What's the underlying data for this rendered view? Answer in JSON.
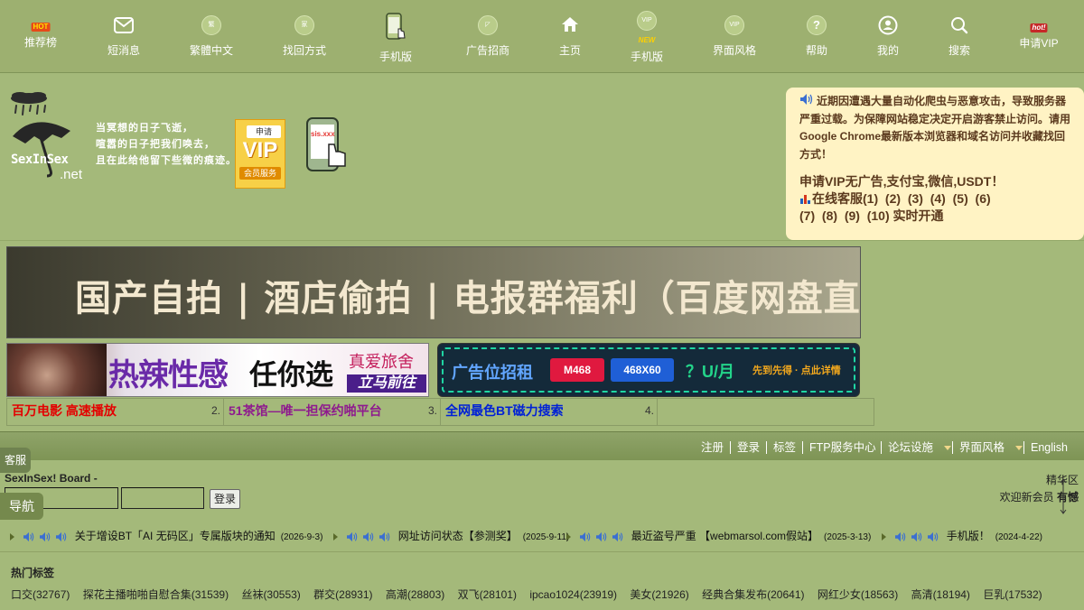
{
  "topnav": {
    "items": [
      {
        "label": "推荐榜",
        "badge": "HOT",
        "icon": "hot-icon"
      },
      {
        "label": "短消息",
        "icon": "mail-icon"
      },
      {
        "label": "繁體中文",
        "icon": "traditional-chinese-icon",
        "icon_text": "繁"
      },
      {
        "label": "找回方式",
        "icon": "retrieve-icon",
        "icon_text": "家"
      },
      {
        "label": "手机版",
        "icon": "phone-icon"
      },
      {
        "label": "广告招商",
        "icon": "ad-icon"
      },
      {
        "label": "主页",
        "icon": "home-icon"
      },
      {
        "label": "手机版",
        "badge": "NEW",
        "icon": "vip-icon",
        "icon_text": "VIP"
      },
      {
        "label": "界面风格",
        "icon": "vip-style-icon",
        "icon_text": "VIP"
      },
      {
        "label": "帮助",
        "icon": "help-icon"
      },
      {
        "label": "我的",
        "icon": "user-icon"
      },
      {
        "label": "搜索",
        "icon": "search-icon"
      },
      {
        "label": "申请VIP",
        "badge": "hot!",
        "icon": "vip-apply-icon"
      }
    ]
  },
  "header": {
    "logo_text": "SexInSex",
    "logo_suffix": ".net",
    "poem": [
      "当冥想的日子飞逝，",
      "喧嚣的日子把我们唤去，",
      "且在此给他留下些微的痕迹。"
    ],
    "vip_box": {
      "top": "申请",
      "big": "VIP",
      "bottom": "会员服务"
    },
    "phone_text": "sis.xxx"
  },
  "notice": {
    "text": "近期因遭遇大量自动化爬虫与恶意攻击，导致服务器严重过载。为保障网站稳定决定开启游客禁止访问。请用Google Chrome最新版本浏览器和域名访问并收藏找回方式！",
    "vip_line": "申请VIP无广告,支付宝,微信,USDT！",
    "service_prefix": "在线客服",
    "service_links": [
      "(1)",
      "(2)",
      "(3)",
      "(4)",
      "(5)",
      "(6)",
      "(7)",
      "(8)",
      "(9)",
      "(10)"
    ],
    "service_suffix": "实时开通"
  },
  "ads": {
    "banner1_text": "国产自拍 | 酒店偷拍 | 电报群福利（百度网盘直下）",
    "banner2": {
      "big": "热辣性感",
      "mid": "任你选",
      "tag1": "真爱旅舍",
      "tag2": "立马前往"
    },
    "banner3": {
      "title": "广告位招租",
      "btn1": "M468",
      "btn2": "468X60",
      "price": "？U/月",
      "cta": "先到先得 · 点此详情"
    },
    "text_ads": [
      {
        "text": "百万电影 高速播放",
        "num": "2.",
        "color": "#e40000"
      },
      {
        "text": "51茶馆—唯一担保约啪平台",
        "num": "3.",
        "color": "#8e1a8e"
      },
      {
        "text": "全网最色BT磁力搜索",
        "num": "4.",
        "color": "#0021d6"
      },
      {
        "text": "",
        "num": "",
        "color": "#222222"
      }
    ]
  },
  "menubar": {
    "items": [
      "注册",
      "登录",
      "标签",
      "FTP服务中心",
      "论坛设施",
      "界面风格",
      "English"
    ]
  },
  "login": {
    "kefu": "客服",
    "nav": "导航",
    "board_title": "SexInSex! Board -",
    "login_button": "登录",
    "right_top": "精华区",
    "right_bottom_prefix": "欢迎新会员",
    "right_bottom_name": "有憾"
  },
  "announcements": [
    {
      "text": "关于增设BT「AI 无码区」专属版块的通知",
      "date": "(2026-9-3)"
    },
    {
      "text": "网址访问状态【参测奖】",
      "date": "(2025-9-11)"
    },
    {
      "text": "最近盗号严重 【webmarsol.com假站】",
      "date": "(2025-3-13)"
    },
    {
      "text": "手机版！",
      "date": "(2024-4-22)"
    }
  ],
  "hot_tags": {
    "title": "热门标签",
    "row1": [
      "口交(32767)",
      "探花主播啪啪自慰合集(31539)",
      "丝袜(30553)",
      "群交(28931)",
      "高潮(28803)",
      "双飞(28101)",
      "ipcao1024(23919)",
      "美女(21926)",
      "经典合集发布(20641)",
      "网红少女(18563)",
      "高清(18194)",
      "巨乳(17532)"
    ]
  }
}
